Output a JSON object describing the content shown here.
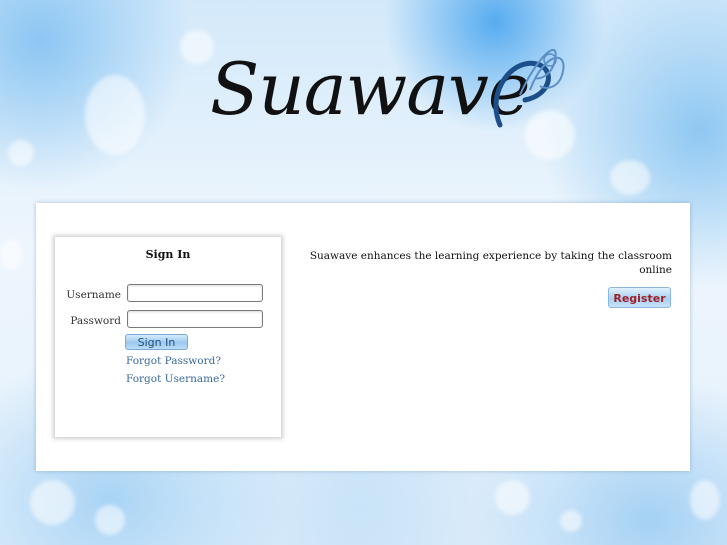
{
  "logo": {
    "text": "Suawave"
  },
  "signin": {
    "title": "Sign In",
    "username_label": "Username",
    "username_value": "",
    "password_label": "Password",
    "password_value": "",
    "button_label": "Sign In",
    "forgot_password": "Forgot Password?",
    "forgot_username": "Forgot Username?"
  },
  "promo": {
    "tagline": "Suawave enhances the learning experience by taking the classroom online",
    "register_label": "Register"
  },
  "colors": {
    "link": "#3a6b9a",
    "register_text": "#a0202a",
    "logo_ink": "#111111",
    "logo_accent": "#1c4f8a"
  }
}
